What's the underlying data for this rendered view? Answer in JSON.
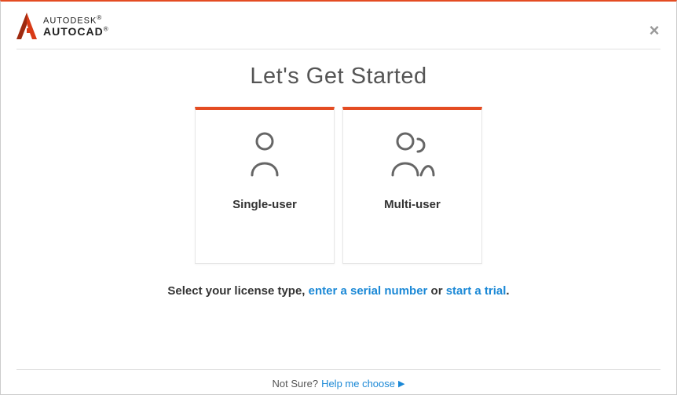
{
  "brand": {
    "line1": "AUTODESK",
    "line2": "AUTOCAD",
    "registered": "®"
  },
  "title": "Let's Get Started",
  "cards": {
    "single": {
      "label": "Single-user",
      "icon": "single-user-icon"
    },
    "multi": {
      "label": "Multi-user",
      "icon": "multi-user-icon"
    }
  },
  "subtext": {
    "prefix": "Select your license type, ",
    "link_serial": "enter a serial number",
    "middle": " or ",
    "link_trial": "start a trial",
    "suffix": "."
  },
  "footer": {
    "prompt": "Not Sure?",
    "link": "Help me choose",
    "chevron": "▶"
  },
  "close_glyph": "×"
}
